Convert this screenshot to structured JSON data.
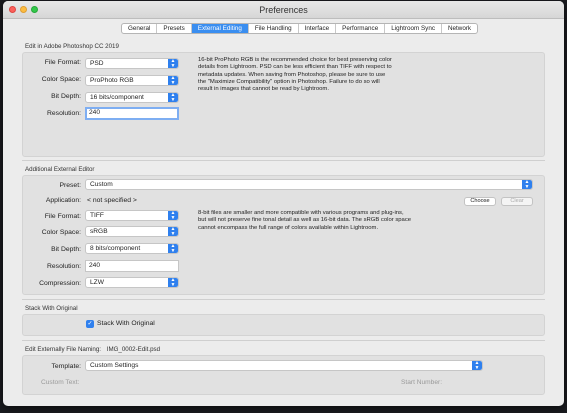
{
  "window": {
    "title": "Preferences"
  },
  "tabs": [
    "General",
    "Presets",
    "External Editing",
    "File Handling",
    "Interface",
    "Performance",
    "Lightroom Sync",
    "Network"
  ],
  "edit_in_photoshop": {
    "section_label": "Edit in Adobe Photoshop CC 2019",
    "file_format": {
      "label": "File Format:",
      "value": "PSD"
    },
    "color_space": {
      "label": "Color Space:",
      "value": "ProPhoto RGB"
    },
    "bit_depth": {
      "label": "Bit Depth:",
      "value": "16 bits/component"
    },
    "resolution": {
      "label": "Resolution:",
      "value": "240"
    },
    "description": "16-bit ProPhoto RGB is the recommended choice for best preserving color details from Lightroom. PSD can be less efficient than TIFF with respect to metadata updates. When saving from Photoshop, please be sure to use the \"Maximize Compatibility\" option in Photoshop. Failure to do so will result in images that cannot be read by Lightroom."
  },
  "additional_editor": {
    "section_label": "Additional External Editor",
    "preset": {
      "label": "Preset:",
      "value": "Custom"
    },
    "application": {
      "label": "Application:",
      "value": "< not specified >"
    },
    "choose_button": "Choose",
    "clear_button": "Clear",
    "file_format": {
      "label": "File Format:",
      "value": "TIFF"
    },
    "color_space": {
      "label": "Color Space:",
      "value": "sRGB"
    },
    "bit_depth": {
      "label": "Bit Depth:",
      "value": "8 bits/component"
    },
    "resolution": {
      "label": "Resolution:",
      "value": "240"
    },
    "compression": {
      "label": "Compression:",
      "value": "LZW"
    },
    "description": "8-bit files are smaller and more compatible with various programs and plug-ins, but will not preserve fine tonal detail as well as 16-bit data. The sRGB color space cannot encompass the full range of colors available within Lightroom."
  },
  "stack": {
    "section_label": "Stack With Original",
    "checkbox_label": "Stack With Original",
    "checked": true
  },
  "naming": {
    "section_label": "Edit Externally File Naming:",
    "example": "IMG_0002-Edit.psd",
    "template": {
      "label": "Template:",
      "value": "Custom Settings"
    },
    "custom_text_label": "Custom Text:",
    "start_number_label": "Start Number:"
  },
  "icons": {
    "dropdown": "chevron-updown-icon",
    "checkbox": "checkmark-icon"
  },
  "colors": {
    "accent": "#3a8ef0",
    "panel": "#e1e1e1",
    "window": "#ececec"
  }
}
